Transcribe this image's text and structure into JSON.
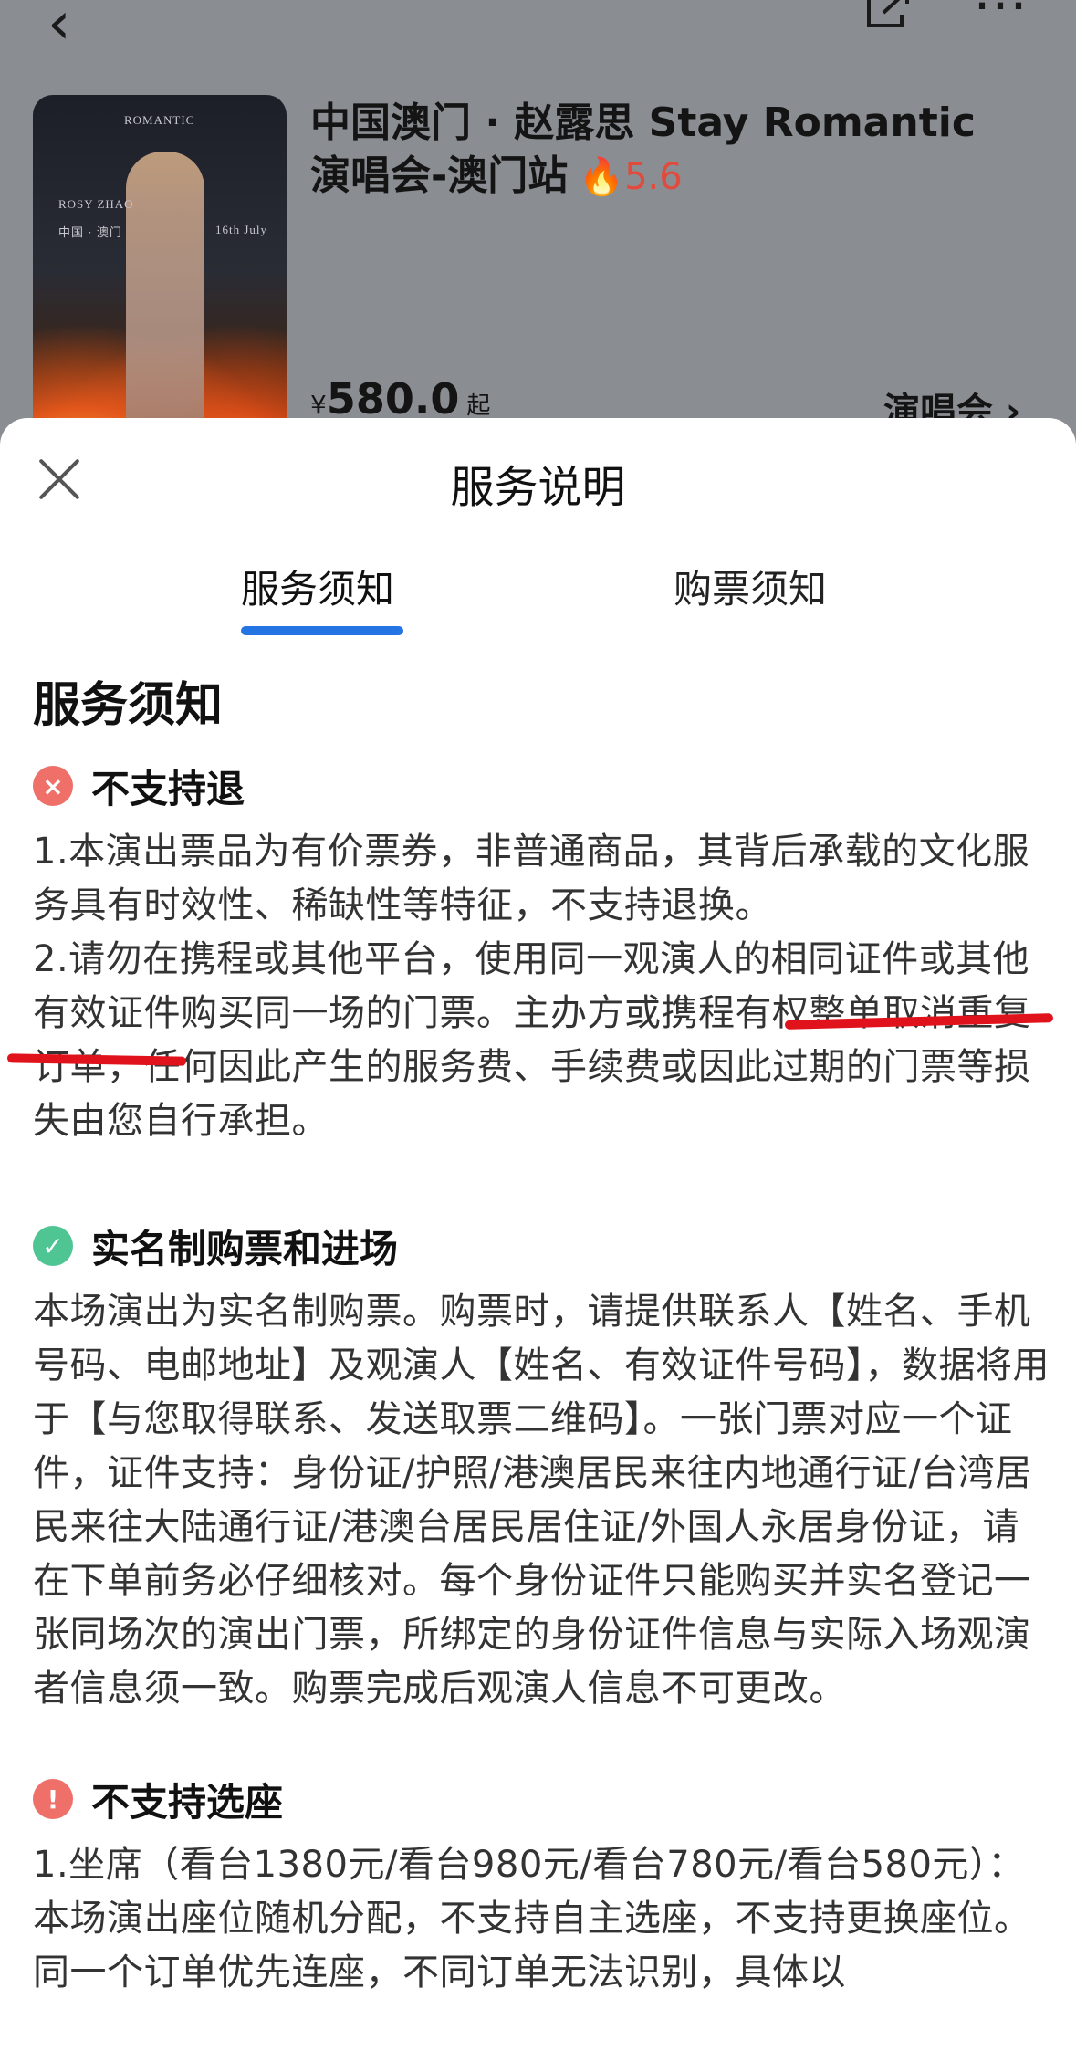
{
  "header": {
    "back_icon": "chevron-left-icon",
    "share_icon": "share-icon",
    "more_icon": "more-icon"
  },
  "event": {
    "poster_text_top": "ROMANTIC",
    "poster_text_name": "ROSY ZHAO",
    "poster_text_city": "中国 · 澳门",
    "poster_text_date": "16th July",
    "title_line1": "中国澳门 · 赵露思 Stay Romantic",
    "title_line2": "演唱会-澳门站",
    "heat": "5.6",
    "price_currency": "¥",
    "price_value": "580.0",
    "price_suffix": "起",
    "tag": "演唱会 ›"
  },
  "sheet": {
    "title": "服务说明",
    "tabs": [
      {
        "label": "服务须知",
        "active": true
      },
      {
        "label": "购票须知",
        "active": false
      }
    ],
    "accent_color": "#2474e3",
    "section_title": "服务须知",
    "items": [
      {
        "icon": "x-circle-icon",
        "heading": "不支持退",
        "text": "1.本演出票品为有价票券，非普通商品，其背后承载的文化服务具有时效性、稀缺性等特征，不支持退换。\n2.请勿在携程或其他平台，使用同一观演人的相同证件或其他有效证件购买同一场的门票。主办方或携程有权整单取消重复订单，任何因此产生的服务费、手续费或因此过期的门票等损失由您自行承担。"
      },
      {
        "icon": "check-circle-icon",
        "heading": "实名制购票和进场",
        "text": "本场演出为实名制购票。购票时，请提供联系人【姓名、手机号码、电邮地址】及观演人【姓名、有效证件号码】，数据将用于【与您取得联系、发送取票二维码】。一张门票对应一个证件，证件支持：身份证/护照/港澳居民来往内地通行证/台湾居民来往大陆通行证/港澳台居民居住证/外国人永居身份证，请在下单前务必仔细核对。每个身份证件只能购买并实名登记一张同场次的演出门票，所绑定的身份证件信息与实际入场观演者信息须一致。购票完成后观演人信息不可更改。"
      },
      {
        "icon": "exclamation-circle-icon",
        "heading": "不支持选座",
        "text": "1.坐席（看台1380元/看台980元/看台780元/看台580元）：本场演出座位随机分配，不支持自主选座，不支持更换座位。同一个订单优先连座，不同订单无法识别，具体以"
      }
    ]
  }
}
